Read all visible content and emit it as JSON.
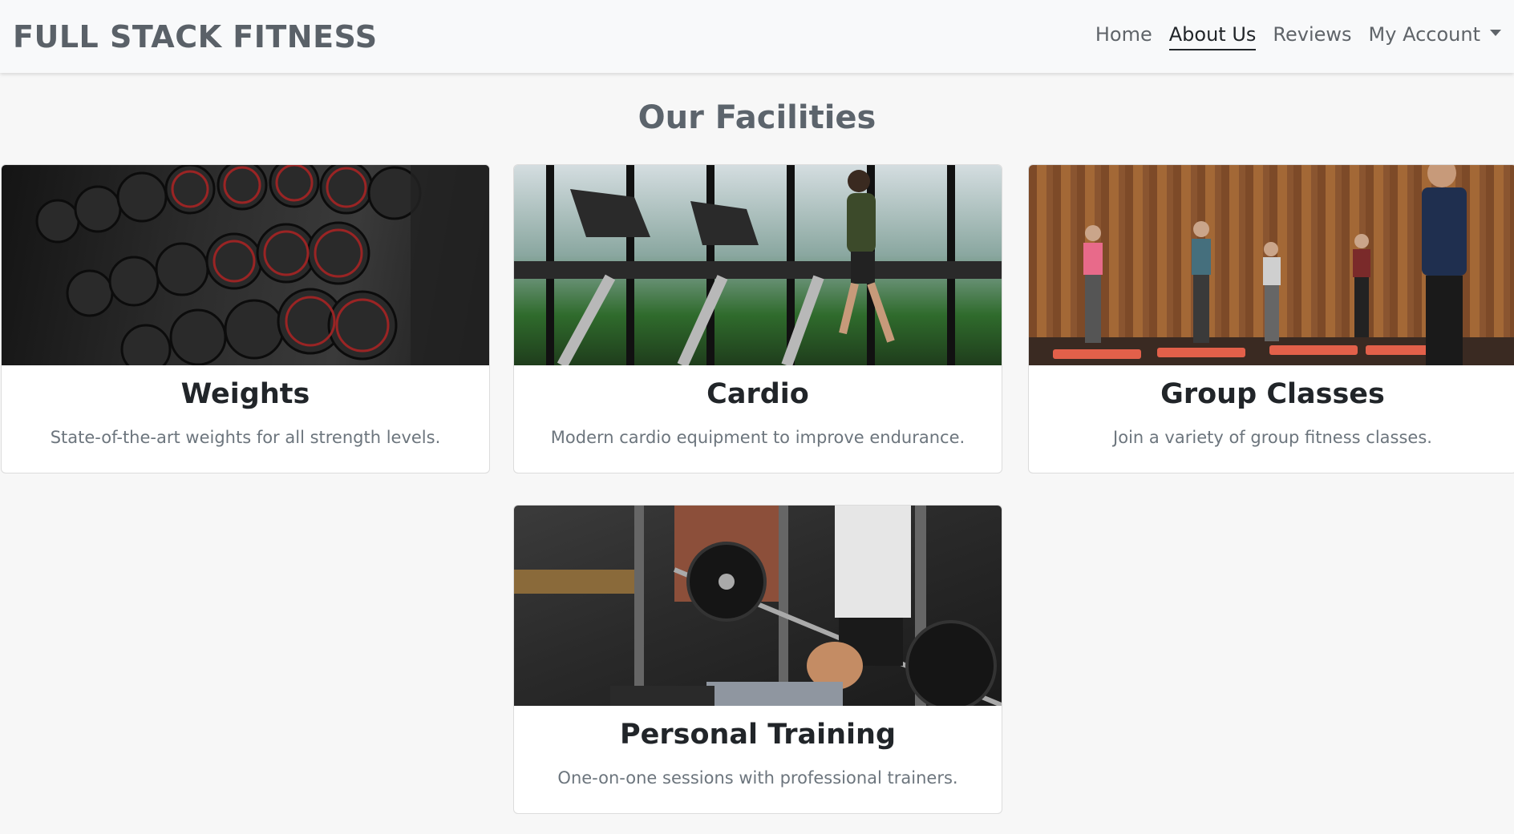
{
  "navbar": {
    "brand": "FULL STACK FITNESS",
    "links": [
      {
        "label": "Home"
      },
      {
        "label": "About Us"
      },
      {
        "label": "Reviews"
      },
      {
        "label": "My Account"
      }
    ]
  },
  "main": {
    "title": "Our Facilities",
    "cards": [
      {
        "title": "Weights",
        "text": "State-of-the-art weights for all strength levels."
      },
      {
        "title": "Cardio",
        "text": "Modern cardio equipment to improve endurance."
      },
      {
        "title": "Group Classes",
        "text": "Join a variety of group fitness classes."
      },
      {
        "title": "Personal Training",
        "text": "One-on-one sessions with professional trainers."
      }
    ]
  }
}
